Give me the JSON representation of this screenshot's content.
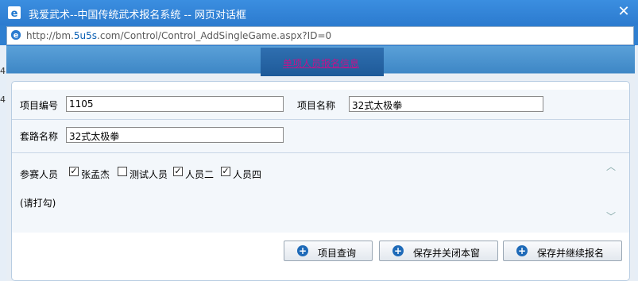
{
  "window": {
    "title": "我爱武术--中国传统武术报名系统 -- 网页对话框",
    "url_prefix": "http://bm.",
    "url_domain": "5u5s",
    "url_suffix": ".com/Control/Control_AddSingleGame.aspx?ID=0"
  },
  "header": {
    "link_label": "单项人员报名信息"
  },
  "form": {
    "item_no_label": "项目编号",
    "item_no_value": "1105",
    "item_name_label": "项目名称",
    "item_name_value": "32式太极拳",
    "routine_label": "套路名称",
    "routine_value": "32式太极拳",
    "participants_label": "参赛人员",
    "hint": "(请打勾)",
    "participants": [
      {
        "name": "张孟杰",
        "checked": true
      },
      {
        "name": "测试人员",
        "checked": false
      },
      {
        "name": "人员二",
        "checked": true
      },
      {
        "name": "人员四",
        "checked": true
      }
    ]
  },
  "buttons": {
    "query": "项目查询",
    "save_close": "保存并关闭本窗",
    "save_continue": "保存并继续报名"
  },
  "colors": {
    "accent": "#2c7bcf",
    "link": "#c0148c"
  }
}
